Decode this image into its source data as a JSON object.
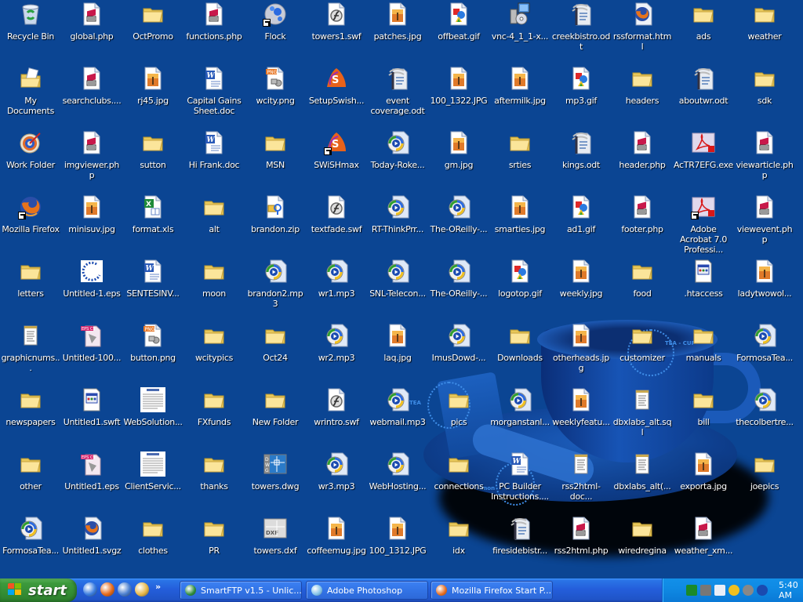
{
  "desktop": {
    "icons": [
      [
        {
          "label": "Recycle Bin",
          "type": "recycle"
        },
        {
          "label": "My Documents",
          "type": "mydocs"
        },
        {
          "label": "Work Folder",
          "type": "target"
        },
        {
          "label": "Mozilla Firefox",
          "type": "firefox",
          "shortcut": true
        },
        {
          "label": "letters",
          "type": "folder"
        },
        {
          "label": "graphicnums...",
          "type": "notepad"
        },
        {
          "label": "newspapers",
          "type": "folder"
        },
        {
          "label": "other",
          "type": "folder"
        },
        {
          "label": "FormosaTea...",
          "type": "media"
        }
      ],
      [
        {
          "label": "global.php",
          "type": "php"
        },
        {
          "label": "searchclubs....",
          "type": "php"
        },
        {
          "label": "imgviewer.php",
          "type": "php"
        },
        {
          "label": "minisuv.jpg",
          "type": "jpg"
        },
        {
          "label": "Untitled-1.eps",
          "type": "epsdots"
        },
        {
          "label": "Untitled-100...",
          "type": "eps"
        },
        {
          "label": "Untitled1.swft",
          "type": "htaccess"
        },
        {
          "label": "Untitled1.eps",
          "type": "eps"
        },
        {
          "label": "Untitled1.svgz",
          "type": "firefoxdoc"
        }
      ],
      [
        {
          "label": "OctPromo",
          "type": "folder"
        },
        {
          "label": "rj45.jpg",
          "type": "jpg"
        },
        {
          "label": "sutton",
          "type": "folder"
        },
        {
          "label": "format.xls",
          "type": "xls"
        },
        {
          "label": "SENTESINV...",
          "type": "doc"
        },
        {
          "label": "button.png",
          "type": "png"
        },
        {
          "label": "WebSolution...",
          "type": "docthumb"
        },
        {
          "label": "ClientServic...",
          "type": "docthumb"
        },
        {
          "label": "clothes",
          "type": "folder"
        }
      ],
      [
        {
          "label": "functions.php",
          "type": "php"
        },
        {
          "label": "Capital Gains Sheet.doc",
          "type": "doc"
        },
        {
          "label": "Hi Frank.doc",
          "type": "doc"
        },
        {
          "label": "alt",
          "type": "folder"
        },
        {
          "label": "moon",
          "type": "folder"
        },
        {
          "label": "wcitypics",
          "type": "folder"
        },
        {
          "label": "FXfunds",
          "type": "folder"
        },
        {
          "label": "thanks",
          "type": "folder"
        },
        {
          "label": "PR",
          "type": "folder"
        }
      ],
      [
        {
          "label": "Flock",
          "type": "flock",
          "shortcut": true
        },
        {
          "label": "wcity.png",
          "type": "png"
        },
        {
          "label": "MSN",
          "type": "folder"
        },
        {
          "label": "brandon.zip",
          "type": "zip"
        },
        {
          "label": "brandon2.mp3",
          "type": "media"
        },
        {
          "label": "Oct24",
          "type": "folder"
        },
        {
          "label": "New Folder",
          "type": "folder"
        },
        {
          "label": "towers.dwg",
          "type": "dwg"
        },
        {
          "label": "towers.dxf",
          "type": "dxf"
        }
      ],
      [
        {
          "label": "towers1.swf",
          "type": "swf"
        },
        {
          "label": "SetupSwish...",
          "type": "swish"
        },
        {
          "label": "SWiSHmax",
          "type": "swish",
          "shortcut": true
        },
        {
          "label": "textfade.swf",
          "type": "swf"
        },
        {
          "label": "wr1.mp3",
          "type": "media"
        },
        {
          "label": "wr2.mp3",
          "type": "media"
        },
        {
          "label": "wrintro.swf",
          "type": "swf"
        },
        {
          "label": "wr3.mp3",
          "type": "media"
        },
        {
          "label": "coffeemug.jpg",
          "type": "jpg"
        }
      ],
      [
        {
          "label": "patches.jpg",
          "type": "jpg"
        },
        {
          "label": "event coverage.odt",
          "type": "odt"
        },
        {
          "label": "Today-Roke...",
          "type": "media"
        },
        {
          "label": "RT-ThinkPrr...",
          "type": "media"
        },
        {
          "label": "SNL-Telecon...",
          "type": "media"
        },
        {
          "label": "laq.jpg",
          "type": "jpg"
        },
        {
          "label": "webmail.mp3",
          "type": "media"
        },
        {
          "label": "WebHosting...",
          "type": "media"
        },
        {
          "label": "100_1312.JPG",
          "type": "jpg"
        }
      ],
      [
        {
          "label": "offbeat.gif",
          "type": "gif"
        },
        {
          "label": "100_1322.JPG",
          "type": "jpg"
        },
        {
          "label": "gm.jpg",
          "type": "jpg"
        },
        {
          "label": "The-OReilly-...",
          "type": "media"
        },
        {
          "label": "The-OReilly-...",
          "type": "media"
        },
        {
          "label": "ImusDowd-...",
          "type": "media"
        },
        {
          "label": "pics",
          "type": "folder"
        },
        {
          "label": "connections",
          "type": "folder"
        },
        {
          "label": "idx",
          "type": "folder"
        }
      ],
      [
        {
          "label": "vnc-4_1_1-x...",
          "type": "installer"
        },
        {
          "label": "aftermilk.jpg",
          "type": "jpg"
        },
        {
          "label": "srties",
          "type": "folder"
        },
        {
          "label": "smarties.jpg",
          "type": "jpg"
        },
        {
          "label": "logotop.gif",
          "type": "gif"
        },
        {
          "label": "Downloads",
          "type": "folder"
        },
        {
          "label": "morganstanl...",
          "type": "media"
        },
        {
          "label": "PC Builder Instructions....",
          "type": "doc"
        },
        {
          "label": "firesidebistr...",
          "type": "odt"
        }
      ],
      [
        {
          "label": "creekbistro.odt",
          "type": "odt"
        },
        {
          "label": "mp3.gif",
          "type": "gif"
        },
        {
          "label": "kings.odt",
          "type": "odt"
        },
        {
          "label": "ad1.gif",
          "type": "gif"
        },
        {
          "label": "weekly.jpg",
          "type": "jpg"
        },
        {
          "label": "otherheads.jpg",
          "type": "jpg"
        },
        {
          "label": "weeklyfeatu...",
          "type": "jpg"
        },
        {
          "label": "rss2html-doc...",
          "type": "notepad"
        },
        {
          "label": "rss2html.php",
          "type": "php"
        }
      ],
      [
        {
          "label": "rssformat.html",
          "type": "firefoxdoc"
        },
        {
          "label": "headers",
          "type": "folder"
        },
        {
          "label": "header.php",
          "type": "php"
        },
        {
          "label": "footer.php",
          "type": "php"
        },
        {
          "label": "food",
          "type": "folder"
        },
        {
          "label": "customizer",
          "type": "folder"
        },
        {
          "label": "dbxlabs_alt.sql",
          "type": "notepad"
        },
        {
          "label": "dbxlabs_alt(...",
          "type": "notepad"
        },
        {
          "label": "wiredregina",
          "type": "folder"
        }
      ],
      [
        {
          "label": "ads",
          "type": "folder"
        },
        {
          "label": "aboutwr.odt",
          "type": "odt"
        },
        {
          "label": "AcTR7EFG.exe",
          "type": "acrobat"
        },
        {
          "label": "Adobe Acrobat 7.0 Professi...",
          "type": "acrobat",
          "shortcut": true
        },
        {
          "label": ".htaccess",
          "type": "htaccess"
        },
        {
          "label": "manuals",
          "type": "folder"
        },
        {
          "label": "bill",
          "type": "folder"
        },
        {
          "label": "exporta.jpg",
          "type": "jpg"
        },
        {
          "label": "weather_xm...",
          "type": "php"
        }
      ],
      [
        {
          "label": "weather",
          "type": "folder"
        },
        {
          "label": "sdk",
          "type": "folder"
        },
        {
          "label": "viewarticle.php",
          "type": "php"
        },
        {
          "label": "viewevent.php",
          "type": "php"
        },
        {
          "label": "ladytwowol...",
          "type": "jpg"
        },
        {
          "label": "FormosaTea...",
          "type": "media"
        },
        {
          "label": "thecolbertre...",
          "type": "media"
        },
        {
          "label": "joepics",
          "type": "folder"
        }
      ]
    ],
    "wallpaper_text": [
      "TEA - CUP",
      "TEA",
      "mon"
    ]
  },
  "taskbar": {
    "start_label": "start",
    "quick_launch": [
      {
        "name": "show-desktop-icon",
        "color": "#3a7de0"
      },
      {
        "name": "firefox-icon",
        "color": "#e66a1a"
      },
      {
        "name": "thunderbird-icon",
        "color": "#4a7fd0"
      },
      {
        "name": "winamp-icon",
        "color": "#e8b84a"
      }
    ],
    "quick_launch_more": "»",
    "tasks": [
      {
        "label": "SmartFTP v1.5 - Unlic...",
        "icon": "smartftp-icon",
        "color": "#2b8a3a"
      },
      {
        "label": "Adobe Photoshop",
        "icon": "photoshop-icon",
        "color": "#7fc0e8"
      },
      {
        "label": "Mozilla Firefox Start P...",
        "icon": "firefox-icon",
        "color": "#e66a1a"
      }
    ],
    "tray": {
      "icons": [
        "vnc-icon",
        "printer-icon",
        "network-monitor-icon",
        "connection-icon",
        "volume-icon",
        "messenger-icon"
      ],
      "clock": "5:40 AM"
    }
  },
  "colors": {
    "desktop_bg": "#0b4593",
    "taskbar": "#245edb",
    "start": "#3c9a3c",
    "tray": "#0f8ae4"
  }
}
